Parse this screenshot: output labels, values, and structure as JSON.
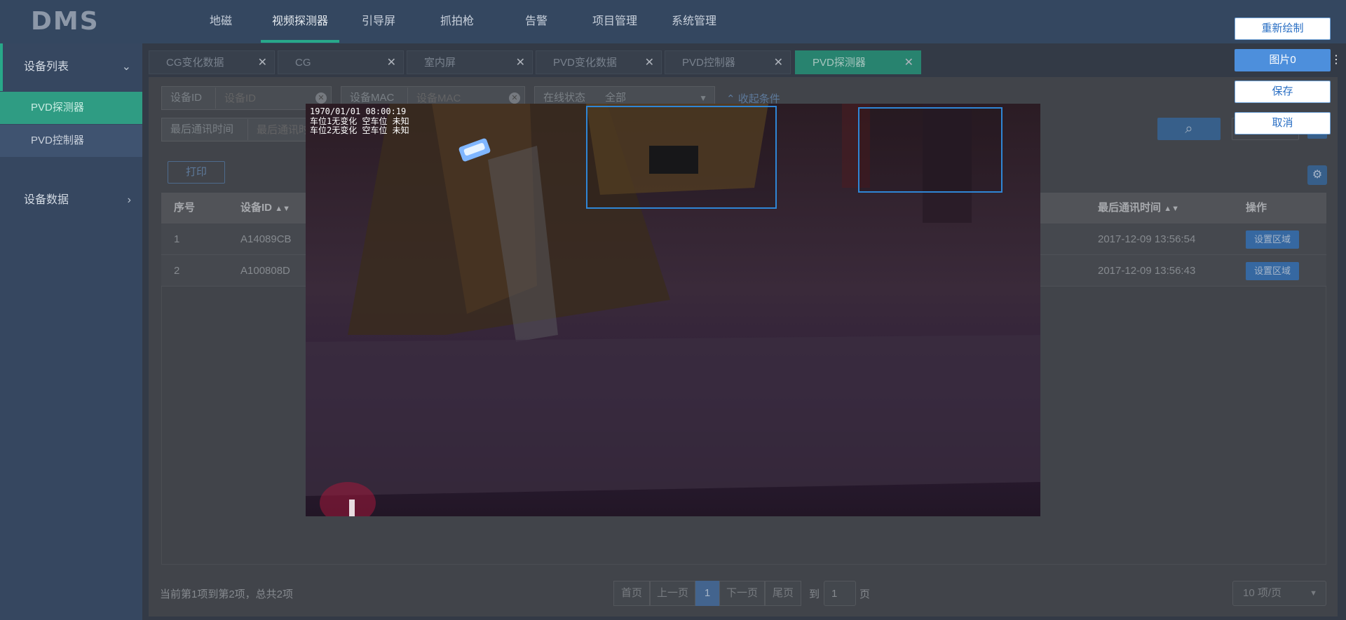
{
  "brand": "DMS",
  "nav": [
    "地磁",
    "视频探测器",
    "引导屏",
    "抓拍枪",
    "告警",
    "项目管理",
    "系统管理"
  ],
  "sidebar": {
    "device_list": "设备列表",
    "items": [
      "PVD探测器",
      "PVD控制器"
    ],
    "device_data": "设备数据"
  },
  "tabs": [
    "CG变化数据",
    "CG",
    "室内屏",
    "PVD变化数据",
    "PVD控制器",
    "PVD探测器"
  ],
  "filters": {
    "device_id_label": "设备ID",
    "device_id_placeholder": "设备ID",
    "device_mac_label": "设备MAC",
    "device_mac_placeholder": "设备MAC",
    "online_label": "在线状态",
    "online_value": "全部",
    "collapse": "收起条件",
    "last_comm_label": "最后通讯时间",
    "last_comm_placeholder": "最后通讯时"
  },
  "toolbar": {
    "print": "打印"
  },
  "table": {
    "headers": {
      "seq": "序号",
      "device_id": "设备ID",
      "last_comm": "最后通讯时间",
      "action": "操作"
    },
    "rows": [
      {
        "seq": "1",
        "device_id": "A14089CB",
        "last_comm": "2017-12-09 13:56:54",
        "action": "设置区域"
      },
      {
        "seq": "2",
        "device_id": "A100808D",
        "last_comm": "2017-12-09 13:56:43",
        "action": "设置区域"
      }
    ]
  },
  "footer": {
    "summary": "当前第1项到第2项，总共2项",
    "first": "首页",
    "prev": "上一页",
    "current": "1",
    "next": "下一页",
    "last": "尾页",
    "goto": "到",
    "goto_value": "1",
    "page": "页",
    "page_size": "10 项/页"
  },
  "video": {
    "timestamp": "1970/01/01 08:00:19",
    "line1": "车位1无变化 空车位 未知",
    "line2": "车位2无变化 空车位 未知"
  },
  "controls": {
    "redraw": "重新绘制",
    "image": "图片0",
    "save": "保存",
    "cancel": "取消"
  },
  "colors": {
    "accent": "#2d9b82",
    "primary": "#4d8fdc",
    "roi": "#2f86d6"
  }
}
